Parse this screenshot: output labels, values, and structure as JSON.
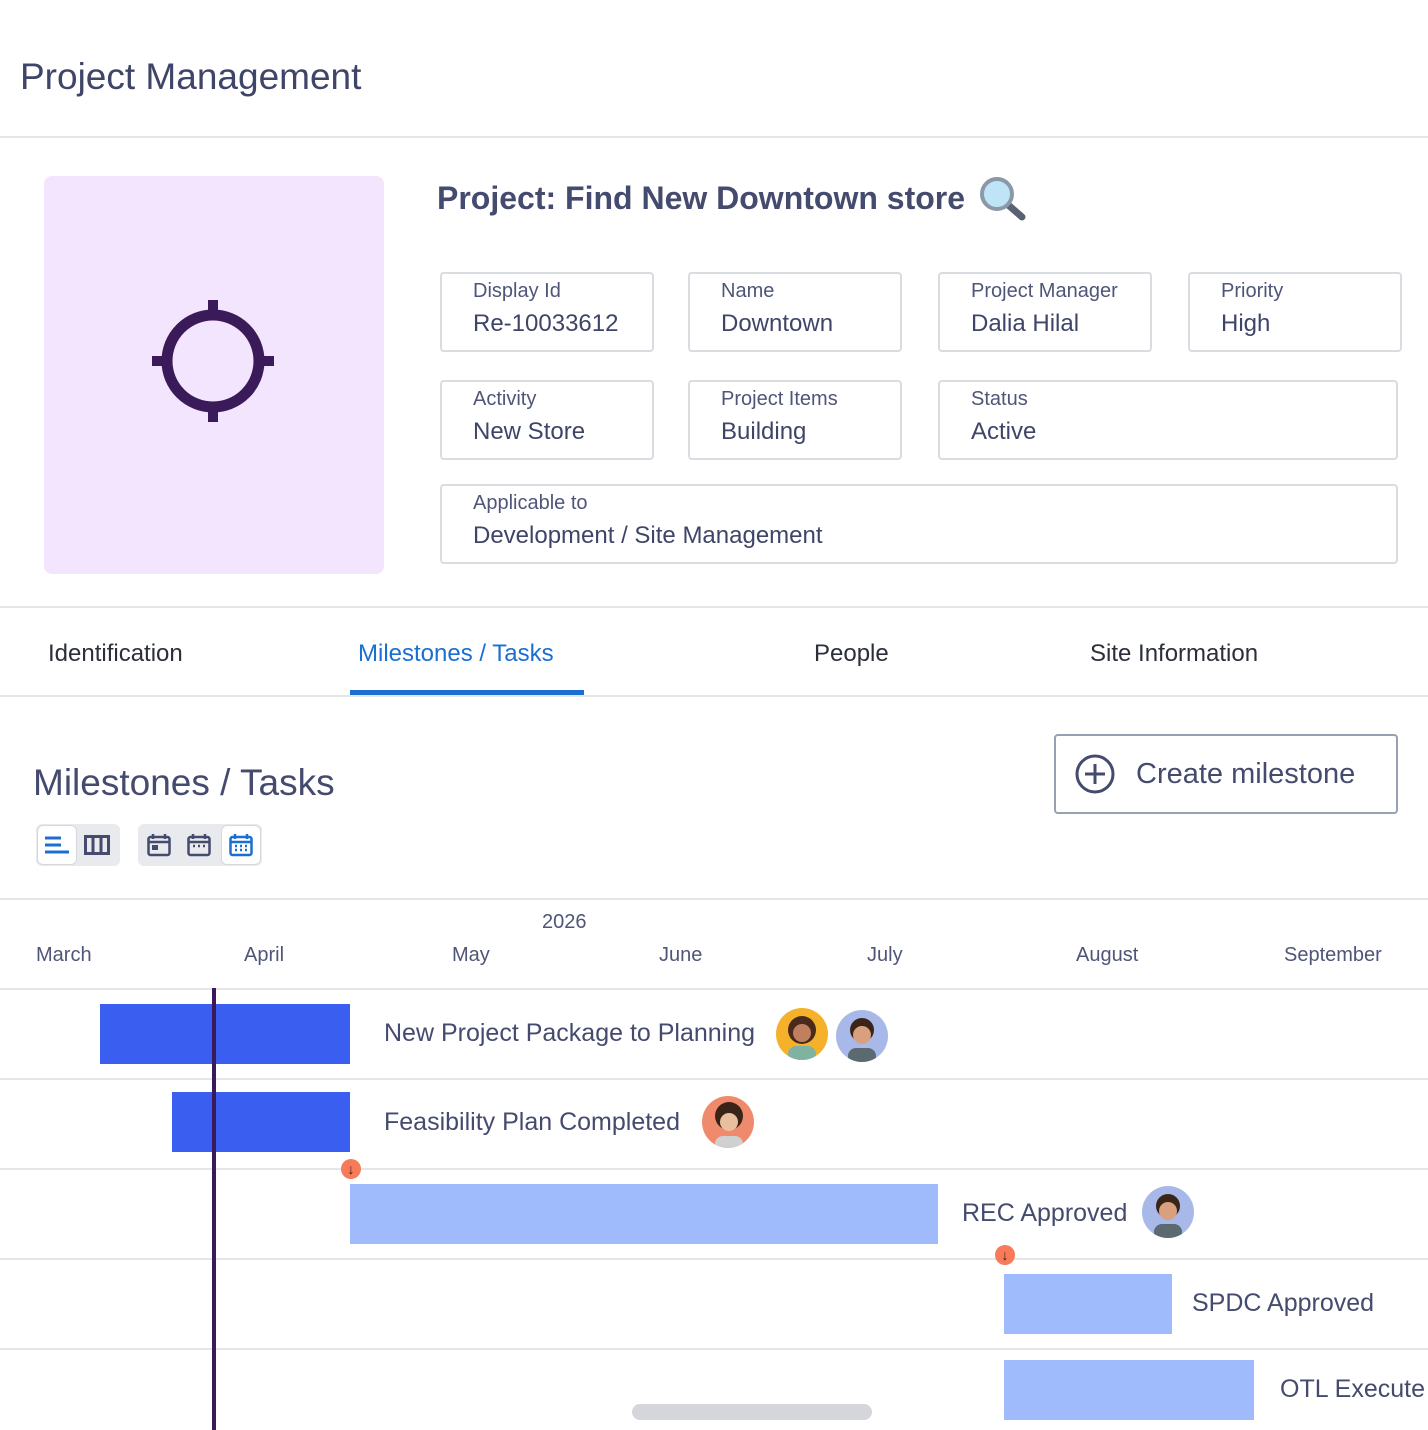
{
  "header": {
    "title": "Project Management"
  },
  "project": {
    "title": "Project: Find New Downtown store",
    "fields": [
      {
        "label": "Display Id",
        "value": "Re-10033612"
      },
      {
        "label": "Name",
        "value": "Downtown"
      },
      {
        "label": "Project Manager",
        "value": "Dalia Hilal"
      },
      {
        "label": "Priority",
        "value": "High"
      },
      {
        "label": "Activity",
        "value": "New Store"
      },
      {
        "label": "Project Items",
        "value": "Building"
      },
      {
        "label": "Status",
        "value": "Active"
      },
      {
        "label": "Applicable to",
        "value": "Development / Site Management"
      }
    ]
  },
  "tabs": [
    {
      "label": "Identification"
    },
    {
      "label": "Milestones / Tasks",
      "active": true
    },
    {
      "label": "People"
    },
    {
      "label": "Site Information"
    }
  ],
  "milestones": {
    "heading": "Milestones / Tasks",
    "create_label": "Create milestone",
    "year": "2026",
    "months": [
      "March",
      "April",
      "May",
      "June",
      "July",
      "August",
      "September"
    ],
    "tasks": [
      {
        "name": "New Project Package to Planning",
        "style": "dark"
      },
      {
        "name": "Feasibility Plan Completed",
        "style": "dark"
      },
      {
        "name": "REC Approved",
        "style": "light"
      },
      {
        "name": "SPDC Approved",
        "style": "light"
      },
      {
        "name": "OTL Execute",
        "style": "light"
      }
    ]
  },
  "colors": {
    "accent": "#1a6fd1",
    "bar_dark": "#3a5ff0",
    "bar_light": "#a0bbfb",
    "today_line": "#3b1a5a",
    "dependency": "#f77a5a",
    "hero_bg": "#f3e5fd"
  }
}
